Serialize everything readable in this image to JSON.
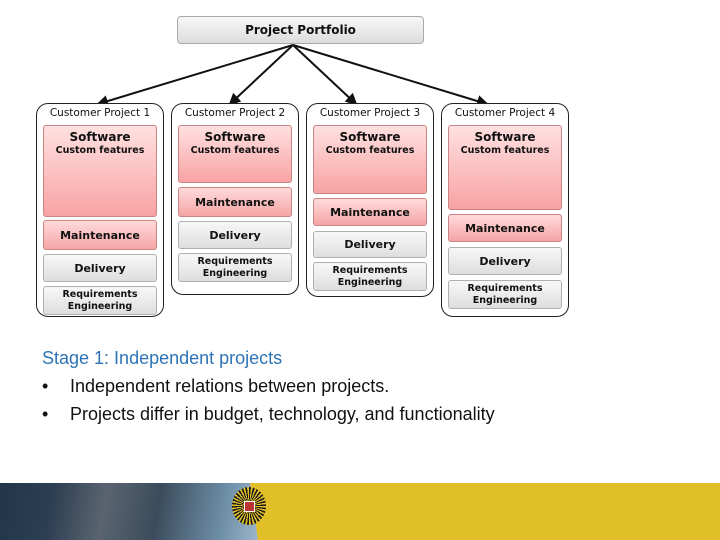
{
  "diagram": {
    "root": "Project Portfolio",
    "projects": [
      {
        "title": "Customer Project 1",
        "software": "Software",
        "custom": "Custom features",
        "maintenance": "Maintenance",
        "delivery": "Delivery",
        "requirements": "Requirements Engineering"
      },
      {
        "title": "Customer Project 2",
        "software": "Software",
        "custom": "Custom features",
        "maintenance": "Maintenance",
        "delivery": "Delivery",
        "requirements": "Requirements Engineering"
      },
      {
        "title": "Customer Project 3",
        "software": "Software",
        "custom": "Custom features",
        "maintenance": "Maintenance",
        "delivery": "Delivery",
        "requirements": "Requirements Engineering"
      },
      {
        "title": "Customer Project 4",
        "software": "Software",
        "custom": "Custom features",
        "maintenance": "Maintenance",
        "delivery": "Delivery",
        "requirements": "Requirements Engineering"
      }
    ]
  },
  "text": {
    "stage_title": "Stage 1: Independent projects",
    "bullets": [
      "Independent relations between projects.",
      "Projects differ in budget, technology, and functionality"
    ],
    "bullet_glyph": "•"
  },
  "footer": {
    "logo": "university-sun-logo-icon",
    "accent_color": "#e0bf27"
  }
}
